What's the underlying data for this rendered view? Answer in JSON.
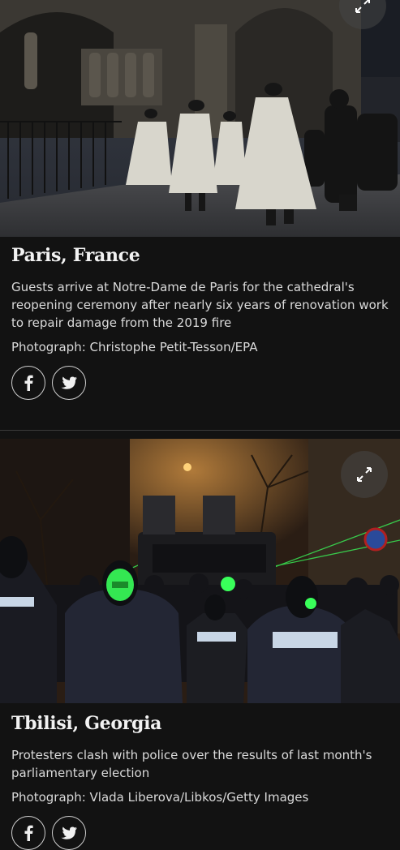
{
  "items": [
    {
      "place": "Paris, France",
      "description": "Guests arrive at Notre-Dame de Paris for the cathedral's reopening ceremony after nearly six years of renovation work to repair damage from the 2019 fire",
      "credit": "Photograph: Christophe Petit-Tesson/EPA",
      "photo_icon": "expand-icon"
    },
    {
      "place": "Tbilisi, Georgia",
      "description": "Protesters clash with police over the results of last month's parliamentary election",
      "credit": "Photograph: Vlada Liberova/Libkos/Getty Images",
      "photo_icon": "expand-icon"
    }
  ],
  "share": {
    "facebook_icon": "facebook-icon",
    "twitter_icon": "twitter-icon"
  },
  "colors": {
    "background": "#121212",
    "laser": "#39ff5a"
  }
}
